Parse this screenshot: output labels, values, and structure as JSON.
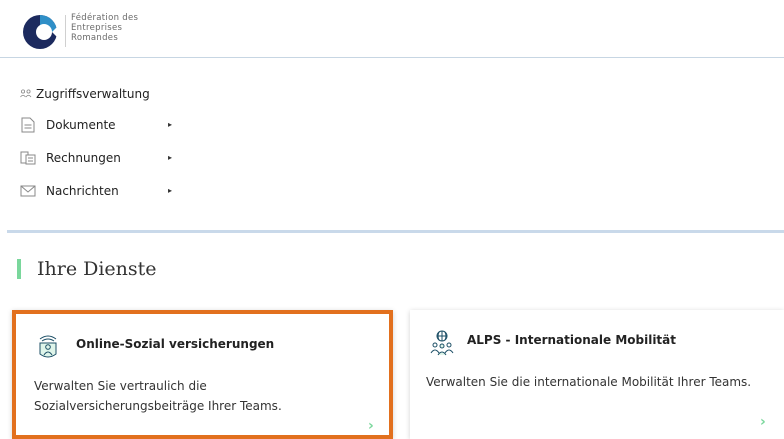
{
  "header": {
    "logo_lines": [
      "Fédération des",
      "Entreprises",
      "Romandes"
    ],
    "logo_icon": "fer-logo-circle"
  },
  "nav": {
    "items": [
      {
        "label": "Zugriffsverwaltung",
        "icon": "users-icon",
        "has_submenu": false
      },
      {
        "label": "Dokumente",
        "icon": "document-icon",
        "has_submenu": true
      },
      {
        "label": "Rechnungen",
        "icon": "invoices-icon",
        "has_submenu": true
      },
      {
        "label": "Nachrichten",
        "icon": "mail-icon",
        "has_submenu": true
      }
    ],
    "caret": "▸"
  },
  "services": {
    "title": "Ihre Dienste",
    "cards": [
      {
        "title": "Online-Sozial versicherungen",
        "description": "Verwalten Sie vertraulich die Sozialversicherungsbeiträge Ihrer Teams.",
        "icon": "social-insurance-icon",
        "selected": true
      },
      {
        "title": "ALPS - Internationale Mobilität",
        "description": "Verwalten Sie die internationale Mobilität Ihrer Teams.",
        "icon": "global-mobility-icon",
        "selected": false
      }
    ],
    "chevron": "›"
  },
  "colors": {
    "accent_green": "#7ad79c",
    "selected_border": "#e2701e",
    "logo_navy": "#1c2a5e",
    "logo_blue": "#2f8fc7",
    "section_line": "#c9d9ea"
  }
}
